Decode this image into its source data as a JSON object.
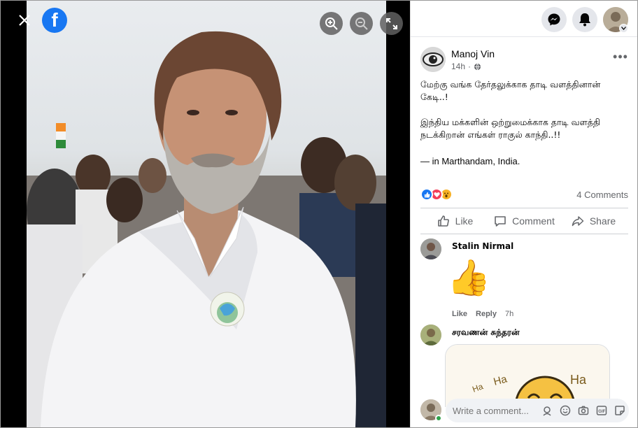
{
  "viewer": {
    "close_icon": "close-icon",
    "logo": "f",
    "zoom_in_icon": "zoom-in-icon",
    "zoom_out_icon": "zoom-out-icon",
    "expand_icon": "fullscreen-icon"
  },
  "topbar": {
    "messenger_icon": "messenger-icon",
    "notifications_icon": "bell-icon",
    "profile_icon": "profile-avatar"
  },
  "post": {
    "author": "Manoj Vin",
    "time": "14h",
    "audience_icon": "globe-icon",
    "more_label": "•••",
    "paragraph_1": "மேற்கு வங்க தேர்தலுக்காக தாடி வளத்தினான் கேடி..!",
    "paragraph_2": "இந்திய மக்களின் ஒற்றுமைக்காக தாடி வளத்தி நடக்கிறான் எங்கள் ராகுல் காந்தி..!!",
    "location_prefix": "— in ",
    "location": "Marthandam, India."
  },
  "reactions": {
    "icons": [
      "like-reaction-icon",
      "love-reaction-icon",
      "wow-reaction-icon"
    ],
    "colors": {
      "like": "#1877f2",
      "love": "#f33e58",
      "wow": "#f7b125"
    },
    "comments_count": "4 Comments"
  },
  "actions": {
    "like": "Like",
    "comment": "Comment",
    "share": "Share"
  },
  "comments": [
    {
      "name": "Stalin Nirmal",
      "sticker": "👍",
      "like": "Like",
      "reply": "Reply",
      "time": "7h"
    },
    {
      "name": "சரவணன் சுந்தரன்",
      "sticker_text": "Ha Ha Ha"
    }
  ],
  "composer": {
    "placeholder": "Write a comment..."
  }
}
